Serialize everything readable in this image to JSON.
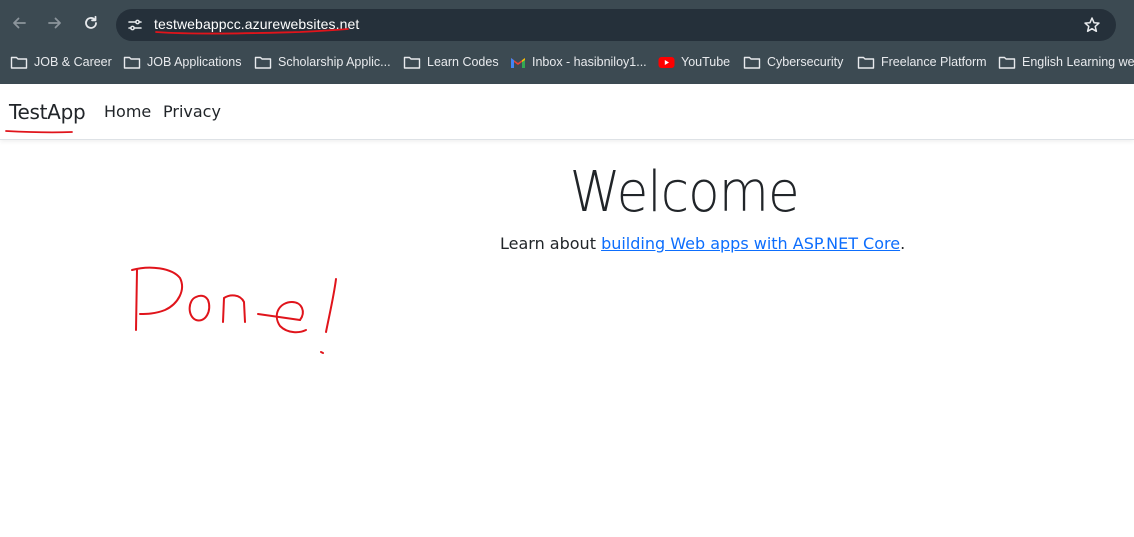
{
  "browser": {
    "url": "testwebappcc.azurewebsites.net",
    "bookmarks": [
      {
        "label": "JOB & Career",
        "icon": "folder-icon"
      },
      {
        "label": "JOB Applications",
        "icon": "folder-icon"
      },
      {
        "label": "Scholarship Applic...",
        "icon": "folder-icon"
      },
      {
        "label": "Learn Codes",
        "icon": "folder-icon"
      },
      {
        "label": "Inbox - hasibniloy1...",
        "icon": "gmail-icon"
      },
      {
        "label": "YouTube",
        "icon": "youtube-icon"
      },
      {
        "label": "Cybersecurity",
        "icon": "folder-icon"
      },
      {
        "label": "Freelance Platform",
        "icon": "folder-icon"
      },
      {
        "label": "English Learning web",
        "icon": "folder-icon"
      }
    ]
  },
  "app": {
    "brand": "TestApp",
    "nav": [
      "Home",
      "Privacy"
    ]
  },
  "main": {
    "heading": "Welcome",
    "learn_prefix": "Learn about ",
    "learn_link": "building Web apps with ASP.NET Core",
    "learn_suffix": "."
  },
  "annotation": {
    "handwritten_text": "Done!",
    "color": "#e0141b"
  },
  "colors": {
    "chrome_bg": "#3c4a52",
    "omnibox_bg": "#25303a",
    "link": "#0d6efd"
  }
}
